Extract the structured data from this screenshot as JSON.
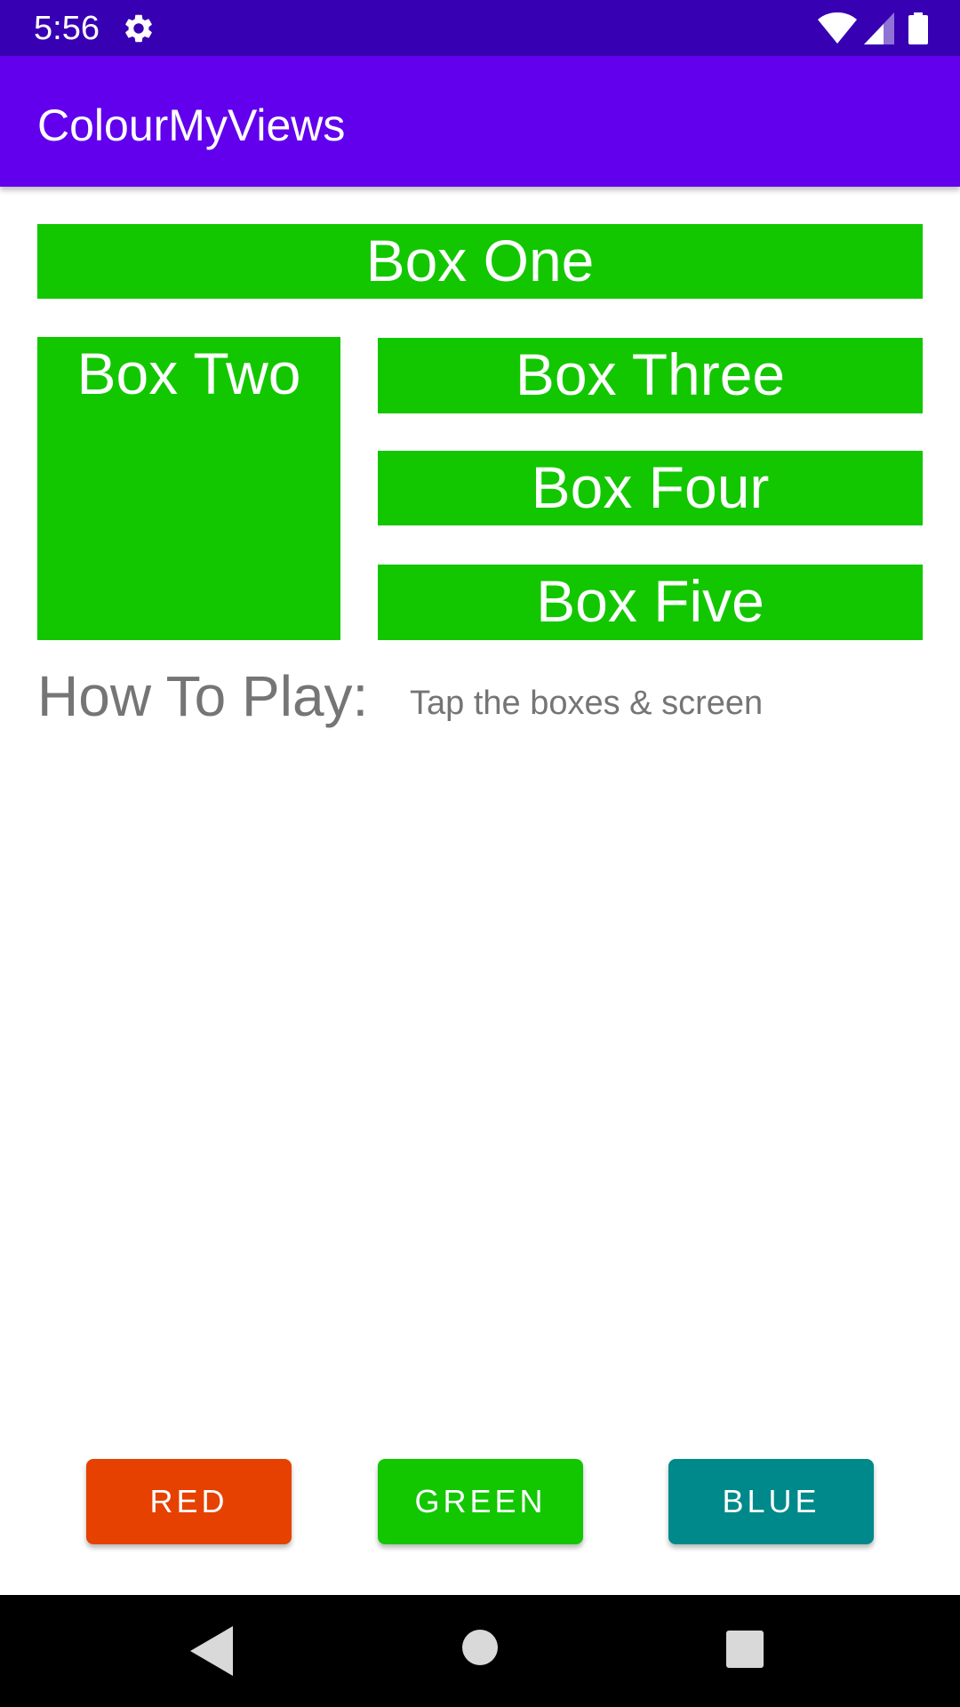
{
  "status_bar": {
    "time": "5:56",
    "icons": [
      "gear-icon",
      "wifi-icon",
      "signal-icon",
      "battery-icon"
    ]
  },
  "app_bar": {
    "title": "ColourMyViews"
  },
  "boxes": [
    {
      "label": "Box One"
    },
    {
      "label": "Box Two"
    },
    {
      "label": "Box Three"
    },
    {
      "label": "Box Four"
    },
    {
      "label": "Box Five"
    }
  ],
  "instructions": {
    "label": "How To Play:",
    "text": "Tap the boxes & screen"
  },
  "buttons": {
    "red": "RED",
    "green": "GREEN",
    "blue": "BLUE"
  },
  "nav_bar": {
    "icons": [
      "back-icon",
      "home-icon",
      "recents-icon"
    ]
  },
  "colors": {
    "status_bar": "#3700b3",
    "app_bar": "#6200ee",
    "box_green": "#12c700",
    "button_red": "#e64100",
    "button_green": "#12c700",
    "button_blue": "#00898a",
    "instruction_text": "#757575"
  }
}
